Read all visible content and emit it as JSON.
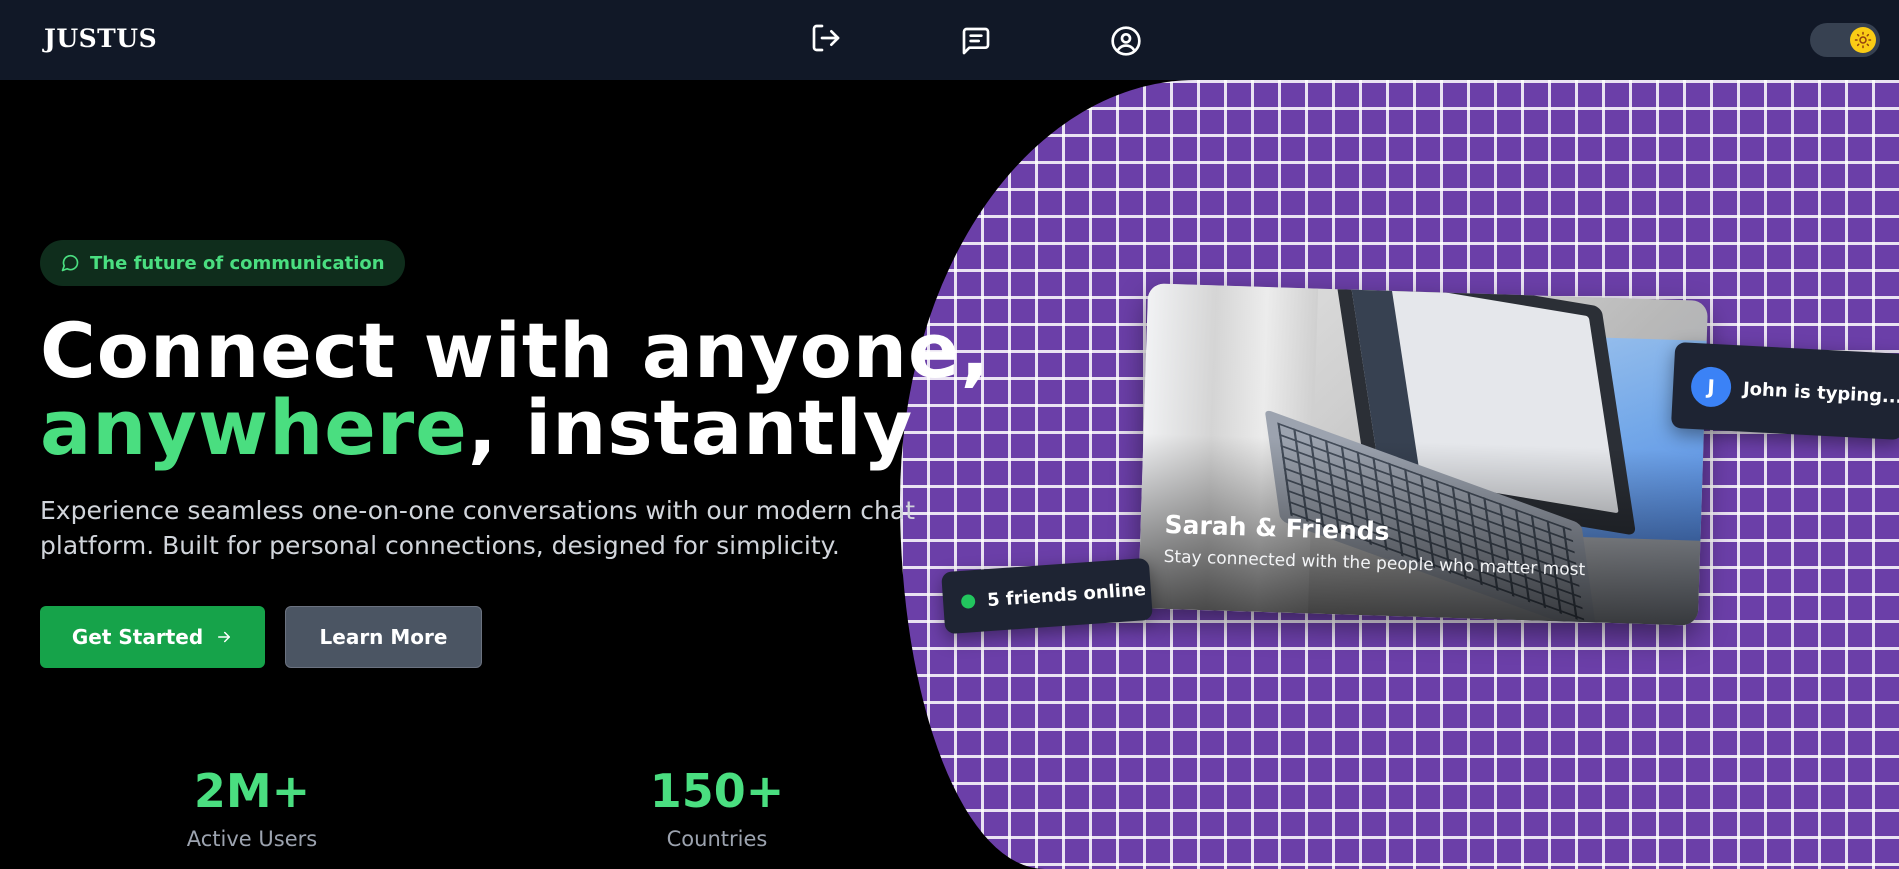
{
  "nav": {
    "logo": "JUSTUS",
    "icons": [
      "logout-icon",
      "messages-icon",
      "profile-icon"
    ],
    "theme_toggle_icon": "sun-icon"
  },
  "hero": {
    "badge": "The future of communication",
    "headline_line1": "Connect with anyone,",
    "headline_accent": "anywhere",
    "headline_rest": ", instantly",
    "subtext": "Experience seamless one-on-one conversations with our modern chat platform. Built for personal connections, designed for simplicity.",
    "primary_button": "Get Started",
    "secondary_button": "Learn More"
  },
  "stats": [
    {
      "value": "2M+",
      "label": "Active Users"
    },
    {
      "value": "150+",
      "label": "Countries"
    }
  ],
  "showcase": {
    "card_title": "Sarah & Friends",
    "card_subtitle": "Stay connected with the people who matter most",
    "online_pill": "5 friends online",
    "typing_avatar": "J",
    "typing_text": "John is typing..."
  },
  "colors": {
    "accent": "#4ade80",
    "primary_button": "#16a34a",
    "nav_bg": "#111827",
    "grid_bg": "#6b3fa8"
  }
}
